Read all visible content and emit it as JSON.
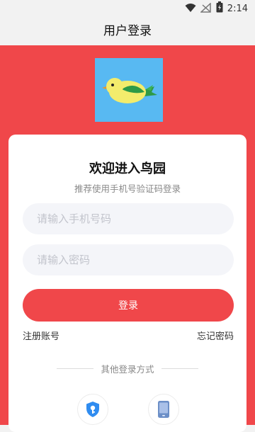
{
  "status_bar": {
    "time": "2:14"
  },
  "header": {
    "title": "用户登录"
  },
  "card": {
    "title": "欢迎进入鸟园",
    "subtitle": "推荐使用手机号验证码登录",
    "phone_placeholder": "请输入手机号码",
    "password_placeholder": "请输入密码",
    "login_label": "登录",
    "register_label": "注册账号",
    "forgot_label": "忘记密码",
    "other_methods_label": "其他登录方式"
  },
  "alt_logins": [
    {
      "icon": "shield-key-icon"
    },
    {
      "icon": "phone-icon"
    }
  ],
  "colors": {
    "brand_red": "#f0474a",
    "logo_blue": "#58b9f2",
    "alt_icon_blue": "#2f8cf0"
  }
}
